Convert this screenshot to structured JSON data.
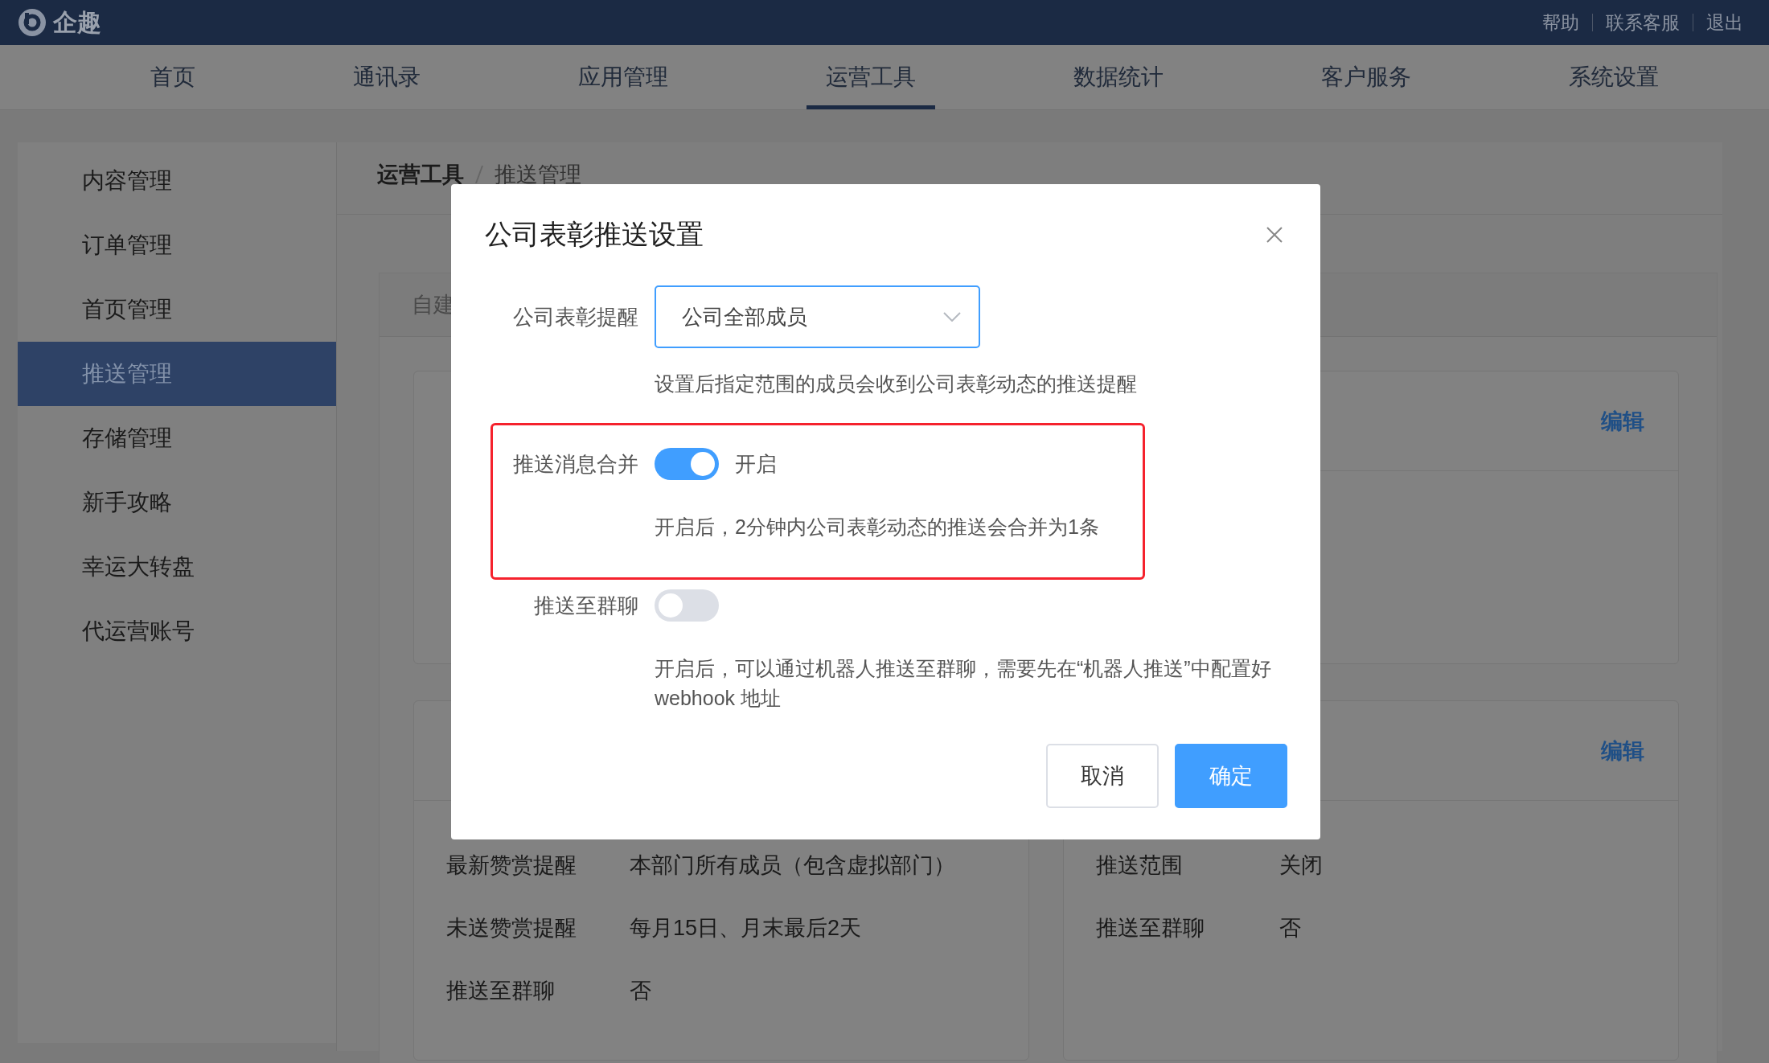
{
  "header": {
    "logo": "企趣",
    "links": [
      "帮助",
      "联系客服",
      "退出"
    ]
  },
  "nav": [
    {
      "label": "首页",
      "selected": false
    },
    {
      "label": "通讯录",
      "selected": false
    },
    {
      "label": "应用管理",
      "selected": false
    },
    {
      "label": "运营工具",
      "selected": true
    },
    {
      "label": "数据统计",
      "selected": false
    },
    {
      "label": "客户服务",
      "selected": false
    },
    {
      "label": "系统设置",
      "selected": false
    }
  ],
  "sidebar": [
    {
      "label": "内容管理",
      "selected": false
    },
    {
      "label": "订单管理",
      "selected": false
    },
    {
      "label": "首页管理",
      "selected": false
    },
    {
      "label": "推送管理",
      "selected": true
    },
    {
      "label": "存储管理",
      "selected": false
    },
    {
      "label": "新手攻略",
      "selected": false
    },
    {
      "label": "幸运大转盘",
      "selected": false
    },
    {
      "label": "代运营账号",
      "selected": false
    }
  ],
  "breadcrumb": [
    "运营工具",
    "推送管理"
  ],
  "content_tabs": [
    "自建"
  ],
  "cards": [
    {
      "action": "编辑"
    },
    {
      "rows": [
        {
          "label": "最新赞赏提醒",
          "value": "本部门所有成员（包含虚拟部门）"
        },
        {
          "label": "未送赞赏提醒",
          "value": "每月15日、月末最后2天"
        },
        {
          "label": "推送至群聊",
          "value": "否"
        }
      ]
    },
    {
      "action": "编辑",
      "rows": [
        {
          "label": "推送范围",
          "value": "关闭"
        },
        {
          "label": "推送至群聊",
          "value": "否"
        }
      ]
    }
  ],
  "dialog": {
    "title": "公司表彰推送设置",
    "fields": [
      {
        "kind": "select",
        "label": "公司表彰提醒",
        "value": "公司全部成员",
        "hint": "设置后指定范围的成员会收到公司表彰动态的推送提醒",
        "highlighted": false
      },
      {
        "kind": "switch",
        "label": "推送消息合并",
        "on": true,
        "state_text": "开启",
        "hint": "开启后，2分钟内公司表彰动态的推送会合并为1条",
        "highlighted": true
      },
      {
        "kind": "switch",
        "label": "推送至群聊",
        "on": false,
        "hint": "开启后，可以通过机器人推送至群聊，需要先在“机器人推送”中配置好 webhook 地址",
        "highlighted": false
      }
    ],
    "buttons": [
      {
        "label": "取消",
        "kind": "default"
      },
      {
        "label": "确定",
        "kind": "primary"
      }
    ]
  }
}
